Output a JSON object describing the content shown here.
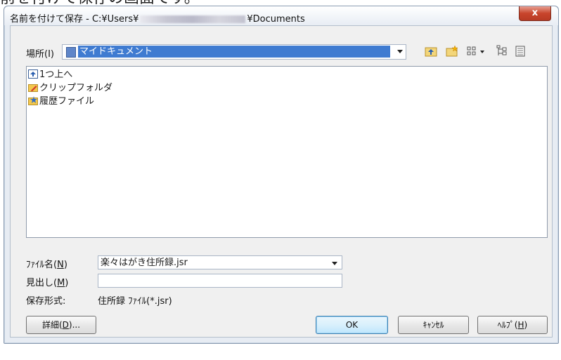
{
  "page_caption": "前を付けて保存の画面です。",
  "window": {
    "title_prefix": "名前を付けて保存 - C:¥Users¥",
    "title_suffix": "¥Documents",
    "close_label": "x"
  },
  "location": {
    "label": "場所(I)",
    "value": "マイドキュメント"
  },
  "toolbar": {
    "icons": [
      "up-folder-icon",
      "new-folder-icon",
      "view-menu-icon",
      "tree-view-icon",
      "details-view-icon"
    ]
  },
  "file_list": {
    "items": [
      {
        "label": "1つ上へ",
        "icon": "up-arrow-icon"
      },
      {
        "label": "クリップフォルダ",
        "icon": "clip-folder-icon"
      },
      {
        "label": "履歴ファイル",
        "icon": "history-folder-icon"
      }
    ]
  },
  "filename": {
    "label": "ﾌｧｲﾙ名(",
    "label_key": "N",
    "value": "楽々はがき住所録.jsr"
  },
  "heading": {
    "label": "見出し(",
    "label_key": "M",
    "value": ""
  },
  "format": {
    "label": "保存形式:",
    "value": "住所録 ﾌｧｲﾙ(*.jsr)"
  },
  "buttons": {
    "details": "詳細(",
    "details_key": "D",
    "details_tail": ")...",
    "ok": "OK",
    "cancel": "ｷｬﾝｾﾙ",
    "help": "ﾍﾙﾌﾟ(",
    "help_key": "H"
  }
}
